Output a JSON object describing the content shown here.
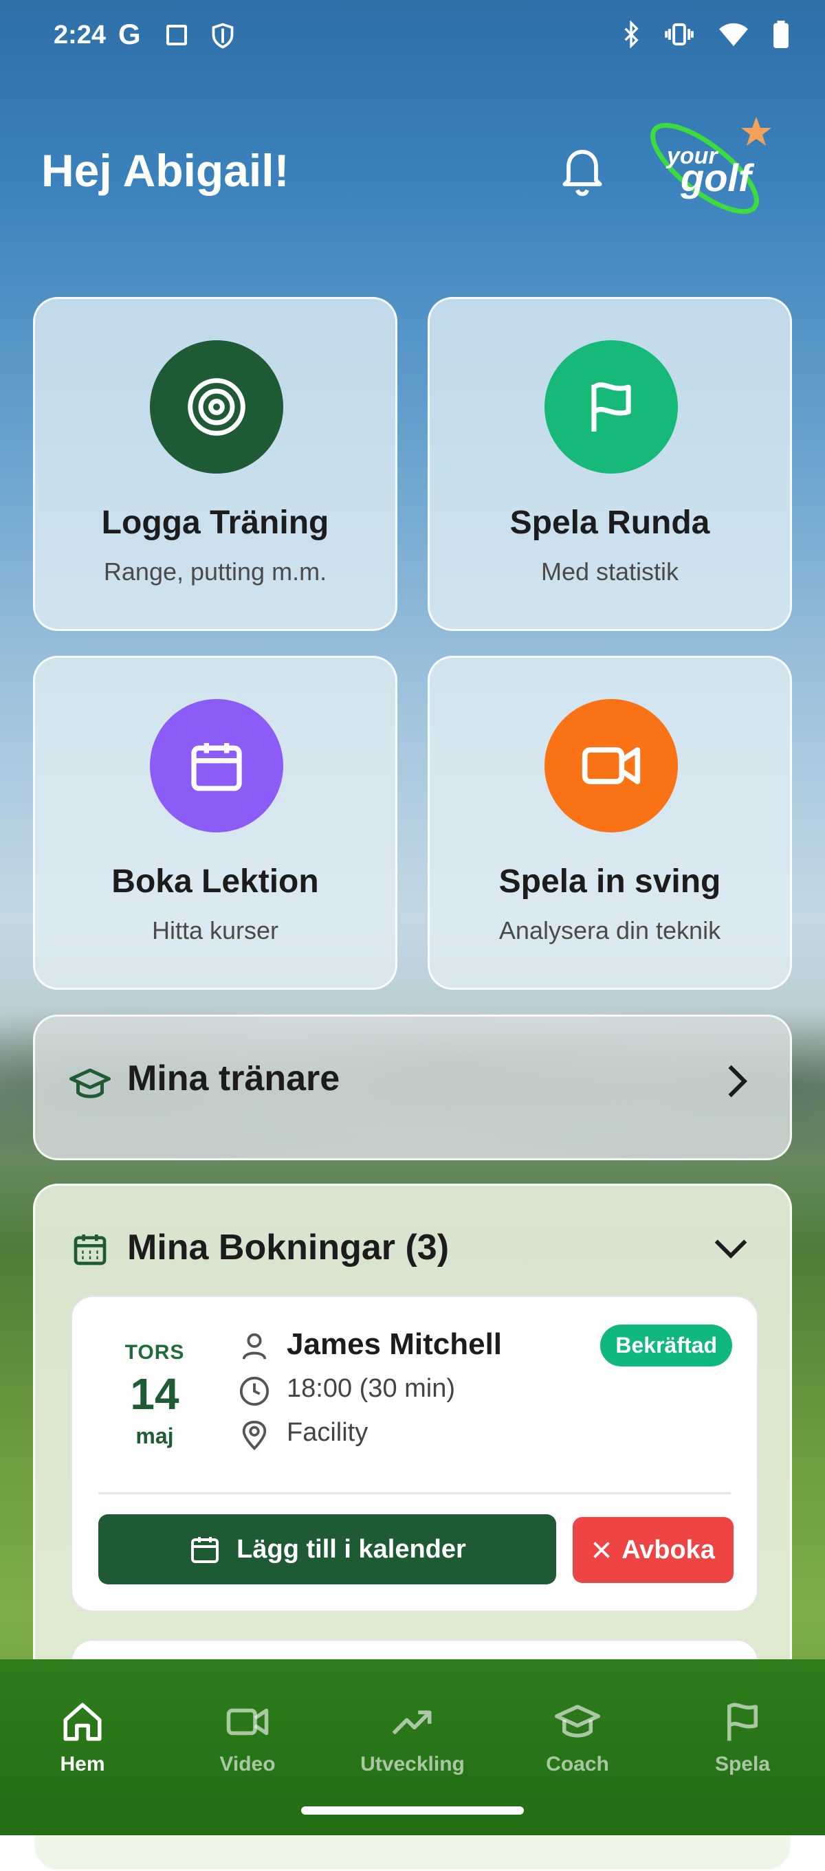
{
  "status_bar": {
    "time": "2:24",
    "g_label": "G"
  },
  "header": {
    "greeting": "Hej Abigail!",
    "logo_text": "your golf"
  },
  "cards": [
    {
      "title": "Logga Träning",
      "subtitle": "Range, putting m.m.",
      "icon": "target-icon",
      "color": "#1e5a34"
    },
    {
      "title": "Spela Runda",
      "subtitle": "Med statistik",
      "icon": "flag-icon",
      "color": "#17b978"
    },
    {
      "title": "Boka Lektion",
      "subtitle": "Hitta kurser",
      "icon": "calendar-icon",
      "color": "#8b5cf6"
    },
    {
      "title": "Spela in sving",
      "subtitle": "Analysera din teknik",
      "icon": "video-icon",
      "color": "#f97316"
    }
  ],
  "trainers": {
    "label": "Mina tränare"
  },
  "bookings": {
    "header": "Mina Bokningar (3)",
    "items": [
      {
        "day": "TORS",
        "date": "14",
        "month": "maj",
        "coach": "James Mitchell",
        "time": "18:00 (30 min)",
        "location": "Facility",
        "status": "Bekräftad",
        "add_calendar": "Lägg till i kalender",
        "cancel": "Avboka"
      }
    ]
  },
  "nav": {
    "items": [
      {
        "label": "Hem",
        "icon": "home-icon",
        "active": true
      },
      {
        "label": "Video",
        "icon": "video-icon",
        "active": false
      },
      {
        "label": "Utveckling",
        "icon": "trend-icon",
        "active": false
      },
      {
        "label": "Coach",
        "icon": "graduation-cap-icon",
        "active": false
      },
      {
        "label": "Spela",
        "icon": "flag-icon",
        "active": false
      }
    ]
  },
  "colors": {
    "primary": "#1e5a34",
    "confirmed": "#10b77f",
    "danger": "#ef4444"
  }
}
